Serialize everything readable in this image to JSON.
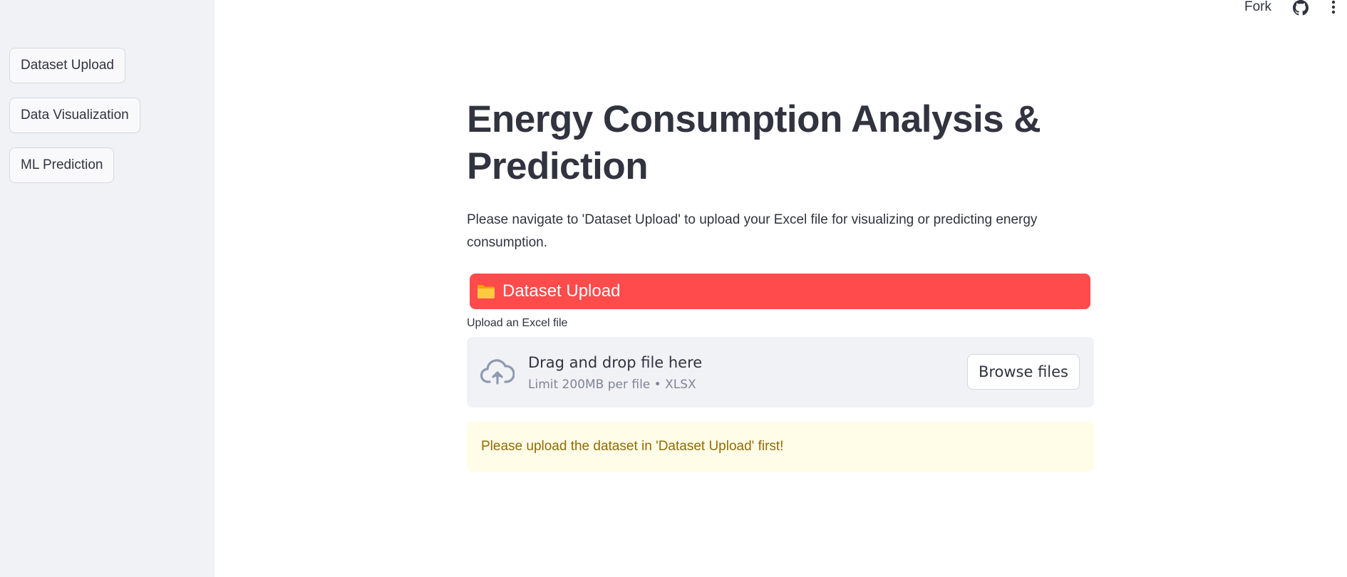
{
  "sidebar": {
    "items": [
      {
        "label": "Dataset Upload"
      },
      {
        "label": "Data Visualization"
      },
      {
        "label": "ML Prediction"
      }
    ]
  },
  "header": {
    "fork_label": "Fork",
    "icons": [
      "github-icon",
      "more-vertical-icon"
    ]
  },
  "main": {
    "title": "Energy Consumption Analysis & Prediction",
    "intro": "Please navigate to 'Dataset Upload' to upload your Excel file for visualizing or predicting energy consumption.",
    "section": {
      "icon": "folder-icon",
      "title": "Dataset Upload",
      "color": "#ff4b4b"
    },
    "uploader": {
      "label": "Upload an Excel file",
      "dropzone_title": "Drag and drop file here",
      "dropzone_limit": "Limit 200MB per file • XLSX",
      "browse_label": "Browse files",
      "icon": "cloud-upload-icon"
    },
    "warning": {
      "text": "Please upload the dataset in 'Dataset Upload' first!",
      "color": "#926c05",
      "background": "#fffce7"
    }
  }
}
